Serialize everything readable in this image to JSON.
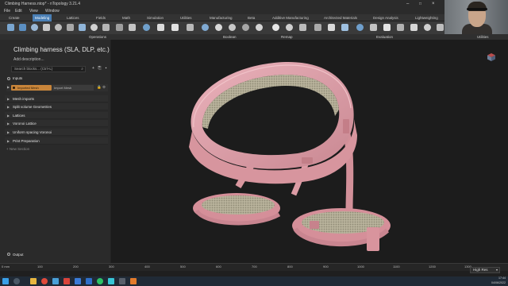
{
  "window": {
    "title": "Climbing Harness.ntop* - nTopology 3.21.4"
  },
  "menu": [
    "File",
    "Edit",
    "View",
    "Window"
  ],
  "tabs": [
    {
      "label": "Create",
      "active": false
    },
    {
      "label": "Modeling",
      "active": true
    },
    {
      "label": "Lattices",
      "active": false
    },
    {
      "label": "Fields",
      "active": false
    },
    {
      "label": "Math",
      "active": false
    },
    {
      "label": "Simulation",
      "active": false
    },
    {
      "label": "Utilities",
      "active": false
    },
    {
      "label": "Manufacturing",
      "active": false
    },
    {
      "label": "Beta",
      "active": false
    },
    {
      "label": "Additive Manufacturing",
      "active": false
    },
    {
      "label": "Architected Materials",
      "active": false
    },
    {
      "label": "Design Analysis",
      "active": false
    },
    {
      "label": "Lightweighting",
      "active": false
    }
  ],
  "toolbar_groups": [
    "Operations",
    "Boolean",
    "Remap",
    "Evaluation",
    "Utilities"
  ],
  "notebook": {
    "title": "Climbing harness (SLA, DLP, etc.)",
    "description_placeholder": "Add description...",
    "search_placeholder": "Search blocks... (Ctrl+L)",
    "inputs_label": "Inputs",
    "imported_mesh": {
      "tag": "Imported Mesh",
      "value": "Import Mesh"
    },
    "sections": [
      "Mesh imports",
      "Split volume Geometries",
      "Lattices",
      "Voronoi Lattice",
      "Uniform spacing Voronoi",
      "Print Preparation"
    ],
    "new_section": "+ New Section",
    "output_label": "Output"
  },
  "ruler": {
    "unit": "0 mm",
    "ticks": [
      "100",
      "200",
      "300",
      "400",
      "500",
      "600",
      "700",
      "800",
      "900",
      "1000",
      "1100",
      "1200",
      "1300"
    ]
  },
  "render_quality": "High Res",
  "clock": {
    "time": "17:44",
    "date": "04/06/2022"
  },
  "colors": {
    "accent": "#4a7fb5",
    "mesh_tag": "#c8853a",
    "harness_pink": "#e3a3ad",
    "lattice_fill": "#b9b39c",
    "viewport_bg": "#1c1c1c"
  }
}
